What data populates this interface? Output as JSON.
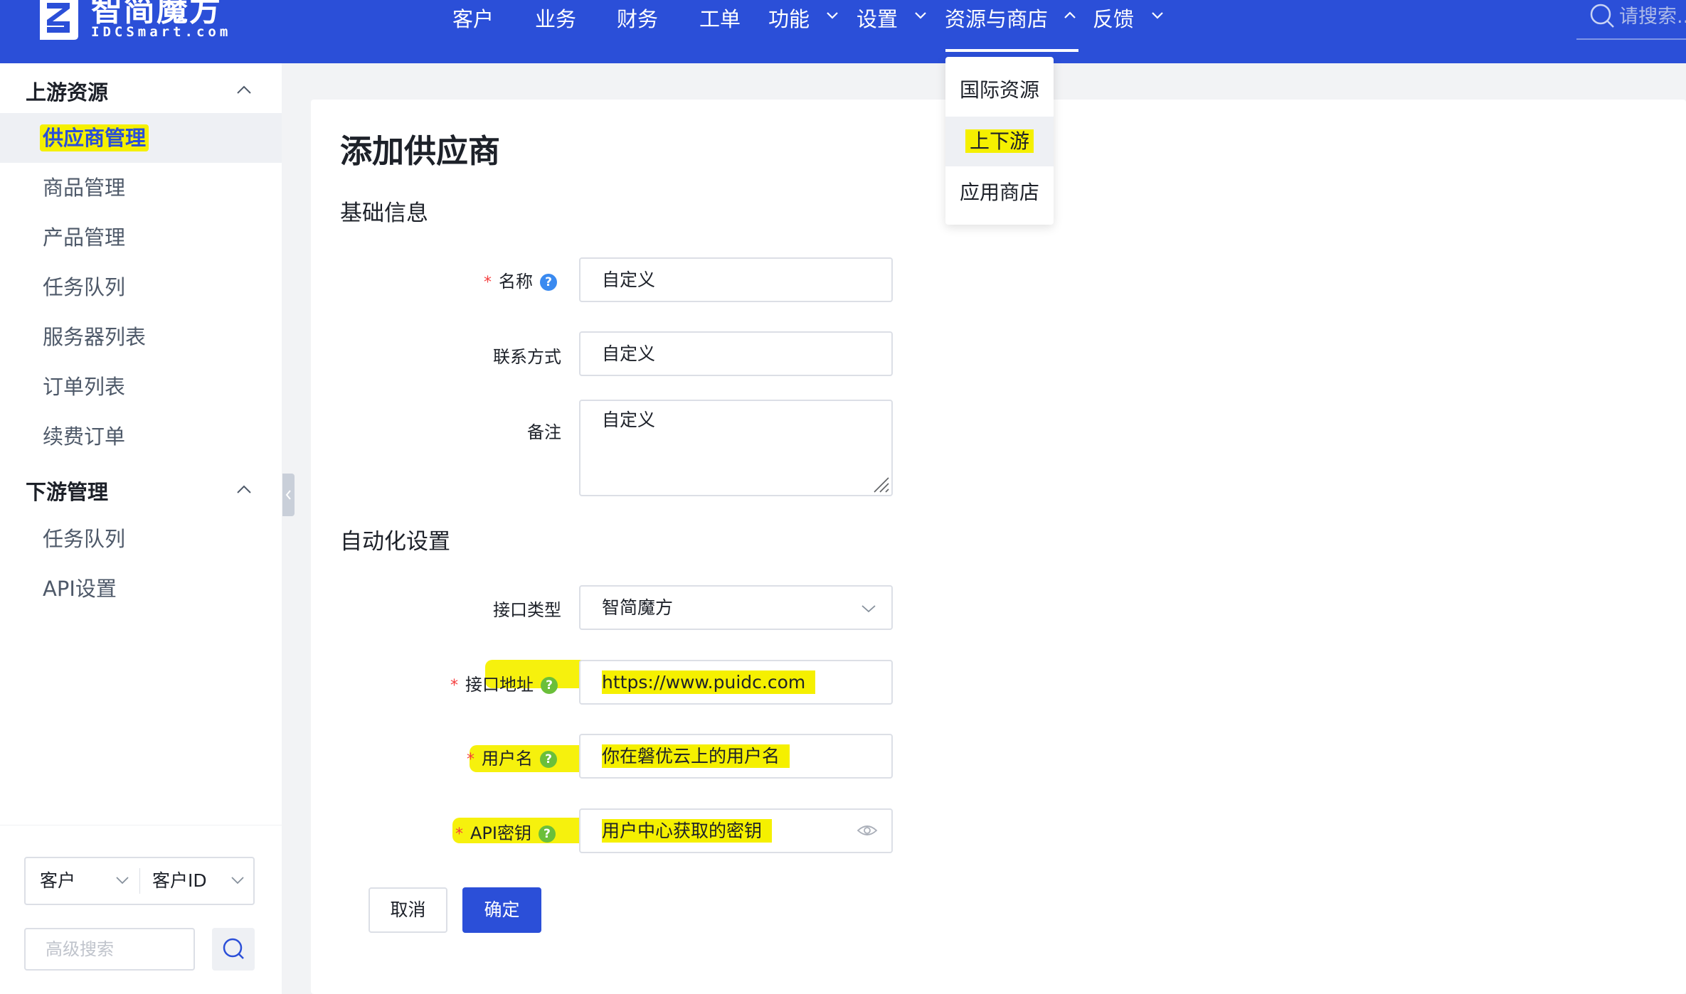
{
  "brand": {
    "name_cn": "智简魔方",
    "name_en": "IDCSmart.com",
    "color": "#2b4fd8"
  },
  "nav": {
    "items": [
      {
        "label": "客户",
        "has_menu": false
      },
      {
        "label": "业务",
        "has_menu": false
      },
      {
        "label": "财务",
        "has_menu": false
      },
      {
        "label": "工单",
        "has_menu": false
      },
      {
        "label": "功能",
        "has_menu": true
      },
      {
        "label": "设置",
        "has_menu": true
      },
      {
        "label": "资源与商店",
        "has_menu": true,
        "active": true
      },
      {
        "label": "反馈",
        "has_menu": true
      }
    ],
    "search_placeholder": "请搜索..."
  },
  "dropdown": {
    "items": [
      {
        "label": "国际资源"
      },
      {
        "label": "上下游",
        "active": true
      },
      {
        "label": "应用商店"
      }
    ]
  },
  "sidebar": {
    "groups": [
      {
        "title": "上游资源",
        "items": [
          "供应商管理",
          "商品管理",
          "产品管理",
          "任务队列",
          "服务器列表",
          "订单列表",
          "续费订单"
        ]
      },
      {
        "title": "下游管理",
        "items": [
          "任务队列",
          "API设置"
        ]
      }
    ],
    "active_item": "供应商管理",
    "search": {
      "type_value": "客户",
      "field_value": "客户ID",
      "advanced_placeholder": "高级搜索"
    }
  },
  "page": {
    "title": "添加供应商",
    "sections": {
      "basic": "基础信息",
      "automation": "自动化设置"
    },
    "form": {
      "name": {
        "label": "名称",
        "value": "自定义",
        "required": true
      },
      "contact": {
        "label": "联系方式",
        "value": "自定义"
      },
      "note": {
        "label": "备注",
        "value": "自定义"
      },
      "api_type": {
        "label": "接口类型",
        "value": "智简魔方"
      },
      "api_url": {
        "label": "接口地址",
        "value": "https://www.puidc.com",
        "required": true
      },
      "username": {
        "label": "用户名",
        "value": "你在磐优云上的用户名",
        "required": true
      },
      "api_key": {
        "label": "API密钥",
        "value": "用户中心获取的密钥",
        "required": true
      }
    },
    "buttons": {
      "cancel": "取消",
      "confirm": "确定"
    }
  },
  "colors": {
    "primary": "#2b4fd8",
    "highlight": "#f5f000",
    "required": "#f53f3f"
  }
}
